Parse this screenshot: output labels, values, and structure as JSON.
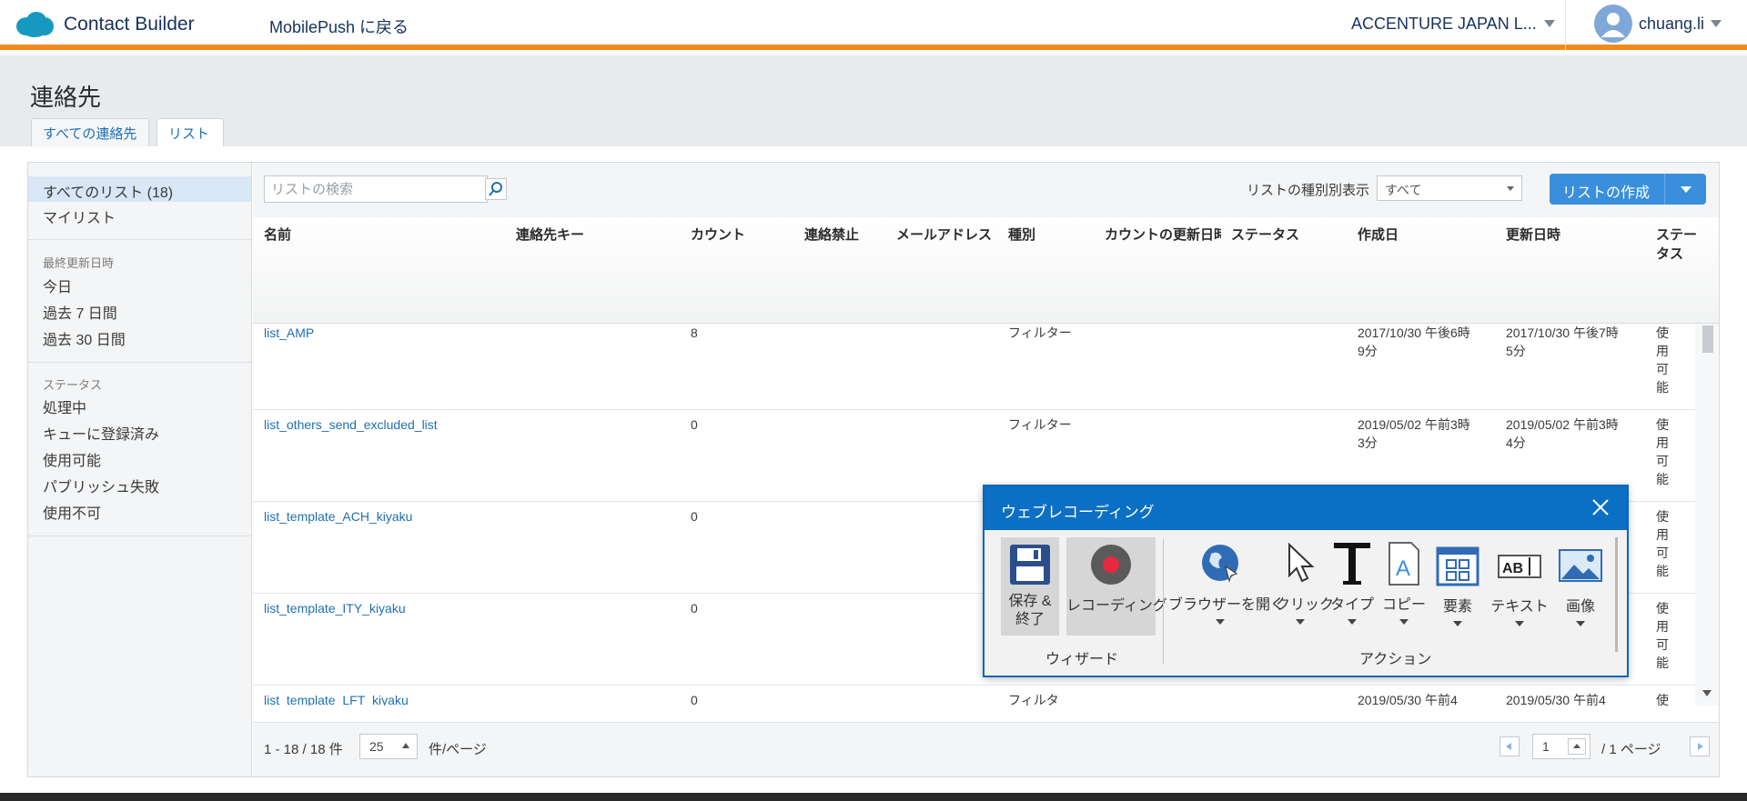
{
  "header": {
    "app_name": "Contact Builder",
    "back_link": "MobilePush に戻る",
    "org_name": "ACCENTURE JAPAN L...",
    "user_name": "chuang.li",
    "accent_color": "#f38b1c",
    "brand_color": "#1798c1"
  },
  "page": {
    "title": "連絡先",
    "tabs": [
      {
        "label": "すべての連絡先"
      },
      {
        "label": "リスト"
      }
    ]
  },
  "sidebar": {
    "all_lists": "すべてのリスト (18)",
    "my_lists": "マイリスト",
    "last_updated_heading": "最終更新日時",
    "last_updated": [
      "今日",
      "過去 7 日間",
      "過去 30 日間"
    ],
    "status_heading": "ステータス",
    "statuses": [
      "処理中",
      "キューに登録済み",
      "使用可能",
      "パブリッシュ失敗",
      "使用不可"
    ]
  },
  "toolbar": {
    "search_placeholder": "リストの検索",
    "filter_label": "リストの種別別表示",
    "filter_value": "すべて",
    "create_button": "リストの作成"
  },
  "table": {
    "columns": [
      "名前",
      "連絡先キー",
      "カウント",
      "連絡禁止",
      "メールアドレス",
      "種別",
      "カウントの更新日時",
      "ステータス",
      "作成日",
      "更新日時",
      "ステータス"
    ],
    "rows": [
      {
        "name": "list_AMP",
        "count": "8",
        "type": "フィルター",
        "created": "2017/10/30 午後6時9分",
        "updated": "2017/10/30 午後7時5分",
        "status": "使用可能"
      },
      {
        "name": "list_others_send_excluded_list",
        "count": "0",
        "type": "フィルター",
        "created": "2019/05/02 午前3時3分",
        "updated": "2019/05/02 午前3時4分",
        "status": "使用可能"
      },
      {
        "name": "list_template_ACH_kiyaku",
        "count": "0",
        "type": "",
        "created": "",
        "updated": "",
        "status": "使用可能"
      },
      {
        "name": "list_template_ITY_kiyaku",
        "count": "0",
        "type": "",
        "created": "",
        "updated": "",
        "status": "使用可能"
      },
      {
        "name": "list_template_LFT_kiyaku",
        "count": "0",
        "type": "フィルタ",
        "created": "2019/05/30 午前4",
        "updated": "2019/05/30 午前4",
        "status": "使"
      }
    ]
  },
  "footer": {
    "range": "1 - 18 / 18 件",
    "per_page_value": "25",
    "per_page_label": "件/ページ",
    "page_value": "1",
    "page_total": "/ 1 ページ"
  },
  "recorder": {
    "title": "ウェブレコーディング",
    "save_label": "保存 & 終了",
    "record_label": "レコーディング",
    "wizard_group": "ウィザード",
    "actions_group": "アクション",
    "tools": [
      "ブラウザーを開く",
      "クリック",
      "タイプ",
      "コピー",
      "要素",
      "テキスト",
      "画像"
    ]
  }
}
